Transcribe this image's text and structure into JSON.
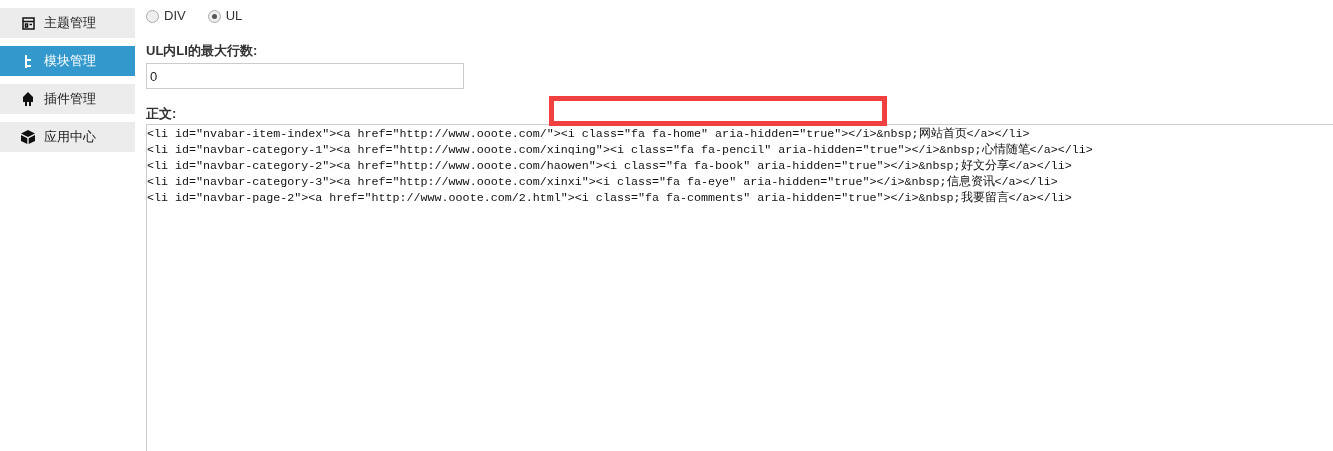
{
  "sidebar": {
    "items": [
      {
        "label": "主题管理",
        "selected": false
      },
      {
        "label": "模块管理",
        "selected": true
      },
      {
        "label": "插件管理",
        "selected": false
      },
      {
        "label": "应用中心",
        "selected": false
      }
    ]
  },
  "type_options": [
    {
      "label": "DIV",
      "selected": false
    },
    {
      "label": "UL",
      "selected": true
    }
  ],
  "max_rows": {
    "label": "UL内LI的最大行数:",
    "value": "0"
  },
  "body": {
    "label": "正文:",
    "lines": [
      "<li id=\"nvabar-item-index\"><a href=\"http://www.ooote.com/\"><i class=\"fa fa-home\" aria-hidden=\"true\"></i>&nbsp;网站首页</a></li>",
      "<li id=\"navbar-category-1\"><a href=\"http://www.ooote.com/xinqing\"><i class=\"fa fa-pencil\" aria-hidden=\"true\"></i>&nbsp;心情随笔</a></li>",
      "<li id=\"navbar-category-2\"><a href=\"http://www.ooote.com/haowen\"><i class=\"fa fa-book\" aria-hidden=\"true\"></i>&nbsp;好文分享</a></li>",
      "<li id=\"navbar-category-3\"><a href=\"http://www.ooote.com/xinxi\"><i class=\"fa fa-eye\" aria-hidden=\"true\"></i>&nbsp;信息资讯</a></li>",
      "<li id=\"navbar-page-2\"><a href=\"http://www.ooote.com/2.html\"><i class=\"fa fa-comments\" aria-hidden=\"true\"></i>&nbsp;我要留言</a></li>"
    ]
  }
}
